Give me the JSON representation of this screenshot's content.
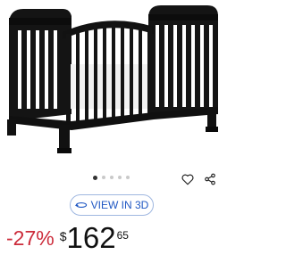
{
  "product": {
    "image_alt": "Black convertible crib",
    "carousel_total": 5,
    "carousel_active": 1
  },
  "actions": {
    "favorite_icon": "heart-icon",
    "share_icon": "share-icon",
    "view3d_label": "VIEW IN 3D",
    "view3d_icon": "3d-rotate-icon"
  },
  "price": {
    "discount": "-27%",
    "currency": "$",
    "whole": "162",
    "cents": "65"
  },
  "colors": {
    "discount": "#cc2b3a",
    "accent": "#1f57c3",
    "text": "#111111",
    "crib": "#111111"
  }
}
